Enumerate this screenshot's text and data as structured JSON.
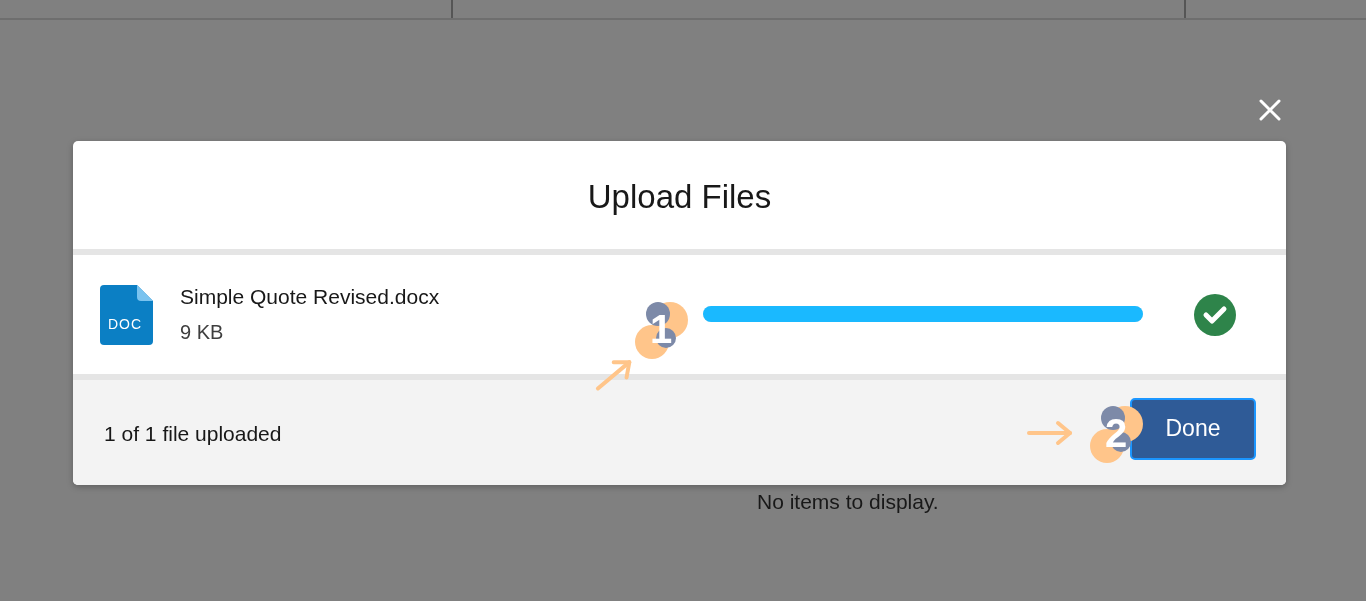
{
  "background": {
    "empty_message": "No items to display."
  },
  "dialog": {
    "title": "Upload Files",
    "files": [
      {
        "icon_label": "DOC",
        "name": "Simple Quote Revised.docx",
        "size": "9 KB",
        "level": 1,
        "complete": true
      }
    ],
    "status": "1 of 1 file uploaded",
    "buttons": [
      {
        "label": "Done"
      }
    ]
  },
  "step_markers": [
    {
      "number": "1"
    },
    {
      "number": "2"
    }
  ]
}
